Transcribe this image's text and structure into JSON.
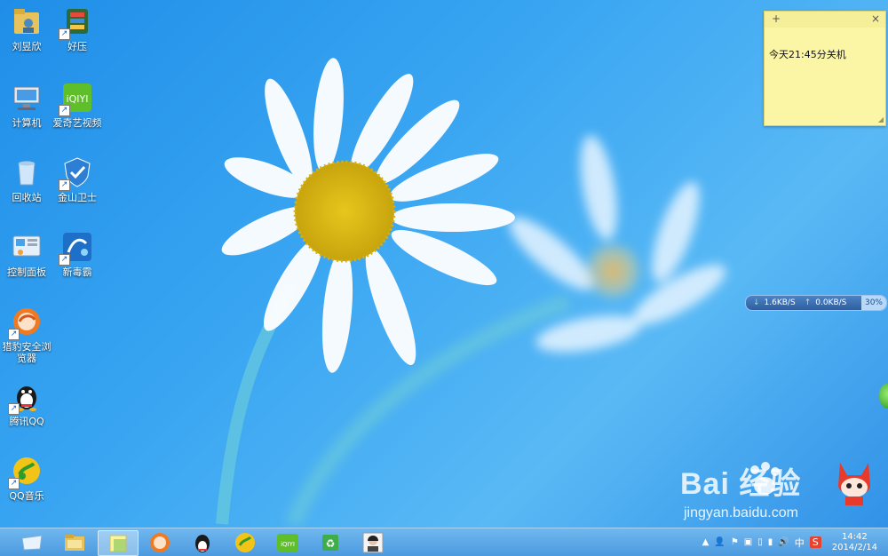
{
  "desktop_icons": [
    {
      "label": "刘昱欣",
      "icon": "folder-user-icon",
      "shortcut": false
    },
    {
      "label": "好压",
      "icon": "haozip-icon",
      "shortcut": true
    },
    {
      "label": "计算机",
      "icon": "computer-icon",
      "shortcut": false
    },
    {
      "label": "爱奇艺视频",
      "icon": "iqiyi-icon",
      "shortcut": true
    },
    {
      "label": "回收站",
      "icon": "recycle-bin-icon",
      "shortcut": false
    },
    {
      "label": "金山卫士",
      "icon": "kingsoft-shield-icon",
      "shortcut": true
    },
    {
      "label": "控制面板",
      "icon": "control-panel-icon",
      "shortcut": false
    },
    {
      "label": "新毒霸",
      "icon": "duba-icon",
      "shortcut": true
    },
    {
      "label": "猎豹安全浏览器",
      "icon": "liebao-browser-icon",
      "shortcut": true
    },
    {
      "label": "腾讯QQ",
      "icon": "qq-icon",
      "shortcut": true
    },
    {
      "label": "QQ音乐",
      "icon": "qq-music-icon",
      "shortcut": true
    }
  ],
  "sticky_note": {
    "add": "+",
    "close": "×",
    "text": "今天21:45分关机"
  },
  "net_speed": {
    "down": "1.6KB/S",
    "up": "0.0KB/S",
    "cpu": "30%"
  },
  "watermark": {
    "brand": "Bai 经验",
    "url": "jingyan.baidu.com"
  },
  "taskbar": {
    "items": [
      "start-button-icon",
      "file-explorer-icon",
      "sticky-notes-icon",
      "liebao-browser-icon",
      "qq-icon",
      "qq-music-icon",
      "iqiyi-icon",
      "recycle-bin-icon",
      "user-photo-icon"
    ],
    "active_index": 2
  },
  "tray": {
    "ime_lang": "中",
    "ime_s": "S",
    "time": "14:42",
    "date": "2014/2/14"
  },
  "colors": {
    "desktop": "#2f95ea",
    "taskbar": "#5aa7e6",
    "sticky": "#fbf5a6"
  }
}
